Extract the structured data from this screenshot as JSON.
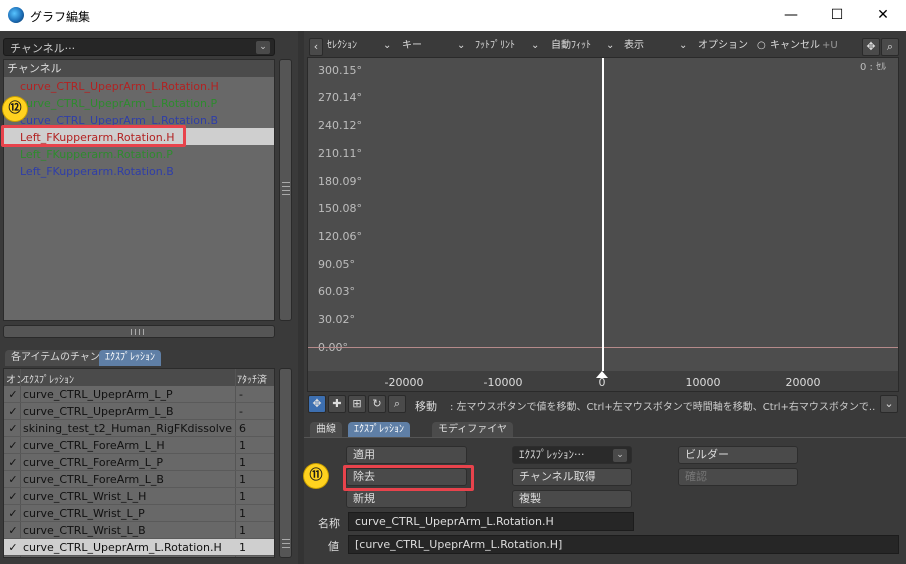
{
  "window": {
    "title": "グラフ編集",
    "minimize": "—",
    "maximize": "☐",
    "close": "✕"
  },
  "left": {
    "channel_dropdown": "チャンネル···",
    "channel_header": "チャンネル",
    "channels": [
      {
        "label": "curve_CTRL_UpeprArm_L.Rotation.H",
        "color": "#b22222"
      },
      {
        "label": "curve_CTRL_UpeprArm_L.Rotation.P",
        "color": "#2e8b2e"
      },
      {
        "label": "curve_CTRL_UpeprArm_L.Rotation.B",
        "color": "#2f3ea8"
      },
      {
        "label": "Left_FKupperarm.Rotation.H",
        "color": "#b22222"
      },
      {
        "label": "Left_FKupperarm.Rotation.P",
        "color": "#2e8b2e"
      },
      {
        "label": "Left_FKupperarm.Rotation.B",
        "color": "#2f3ea8"
      }
    ],
    "tabs": [
      "各アイテムのチャンネル",
      "ｴｸｽﾌﾟﾚｯｼｮﾝ"
    ],
    "table_headers": {
      "on": "オン",
      "expression": "ｴｸｽﾌﾟﾚｯｼｮﾝ",
      "attached": "ｱﾀｯﾁ済"
    },
    "rows": [
      {
        "name": "curve_CTRL_UpeprArm_L_P",
        "att": "-"
      },
      {
        "name": "curve_CTRL_UpeprArm_L_B",
        "att": "-"
      },
      {
        "name": "skining_test_t2_Human_RigFKdissolve",
        "att": "6"
      },
      {
        "name": "curve_CTRL_ForeArm_L_H",
        "att": "1"
      },
      {
        "name": "curve_CTRL_ForeArm_L_P",
        "att": "1"
      },
      {
        "name": "curve_CTRL_ForeArm_L_B",
        "att": "1"
      },
      {
        "name": "curve_CTRL_Wrist_L_H",
        "att": "1"
      },
      {
        "name": "curve_CTRL_Wrist_L_P",
        "att": "1"
      },
      {
        "name": "curve_CTRL_Wrist_L_B",
        "att": "1"
      },
      {
        "name": "curve_CTRL_UpeprArm_L.Rotation.H",
        "att": "1"
      }
    ],
    "check": "✓"
  },
  "toolbar": {
    "back": "‹",
    "selection": "ｾﾚｸｼｮﾝ",
    "key": "キー",
    "footprint": "ﾌｯﾄﾌﾟﾘﾝﾄ",
    "autofit": "自動ﾌｨｯﾄ",
    "display": "表示",
    "options": "オプション",
    "cancel": "キャンセル",
    "cancel_dot": "○",
    "u": "+U",
    "arrow": "⌄"
  },
  "graph": {
    "y_labels": [
      "300.15°",
      "270.14°",
      "240.12°",
      "210.11°",
      "180.09°",
      "150.08°",
      "120.06°",
      "90.05°",
      "60.03°",
      "30.02°",
      "0.00°"
    ],
    "x_labels": [
      "-20000",
      "-10000",
      "0",
      "10000",
      "20000"
    ],
    "frame_readout": "0 : ｾﾙ"
  },
  "status": {
    "mode": "移動",
    "hint": ":  左マウスボタンで値を移動、Ctrl+左マウスボタンで時間軸を移動、Ctrl+右マウスボタンで..."
  },
  "lower": {
    "tabs": [
      "曲線",
      "ｴｸｽﾌﾟﾚｯｼｮﾝ",
      "モディファイヤ"
    ],
    "apply": "適用",
    "remove": "除去",
    "new": "新規",
    "expression_dropdown": "ｴｸｽﾌﾟﾚｯｼｮﾝ···",
    "get_channel": "チャンネル取得",
    "duplicate": "複製",
    "builder": "ビルダー",
    "confirm": "確認",
    "name_label": "名称",
    "name_value": "curve_CTRL_UpeprArm_L.Rotation.H",
    "value_label": "値",
    "value_value": "[curve_CTRL_UpeprArm_L.Rotation.H]"
  },
  "annotations": {
    "badge_11": "⑪",
    "badge_12": "⑫"
  }
}
